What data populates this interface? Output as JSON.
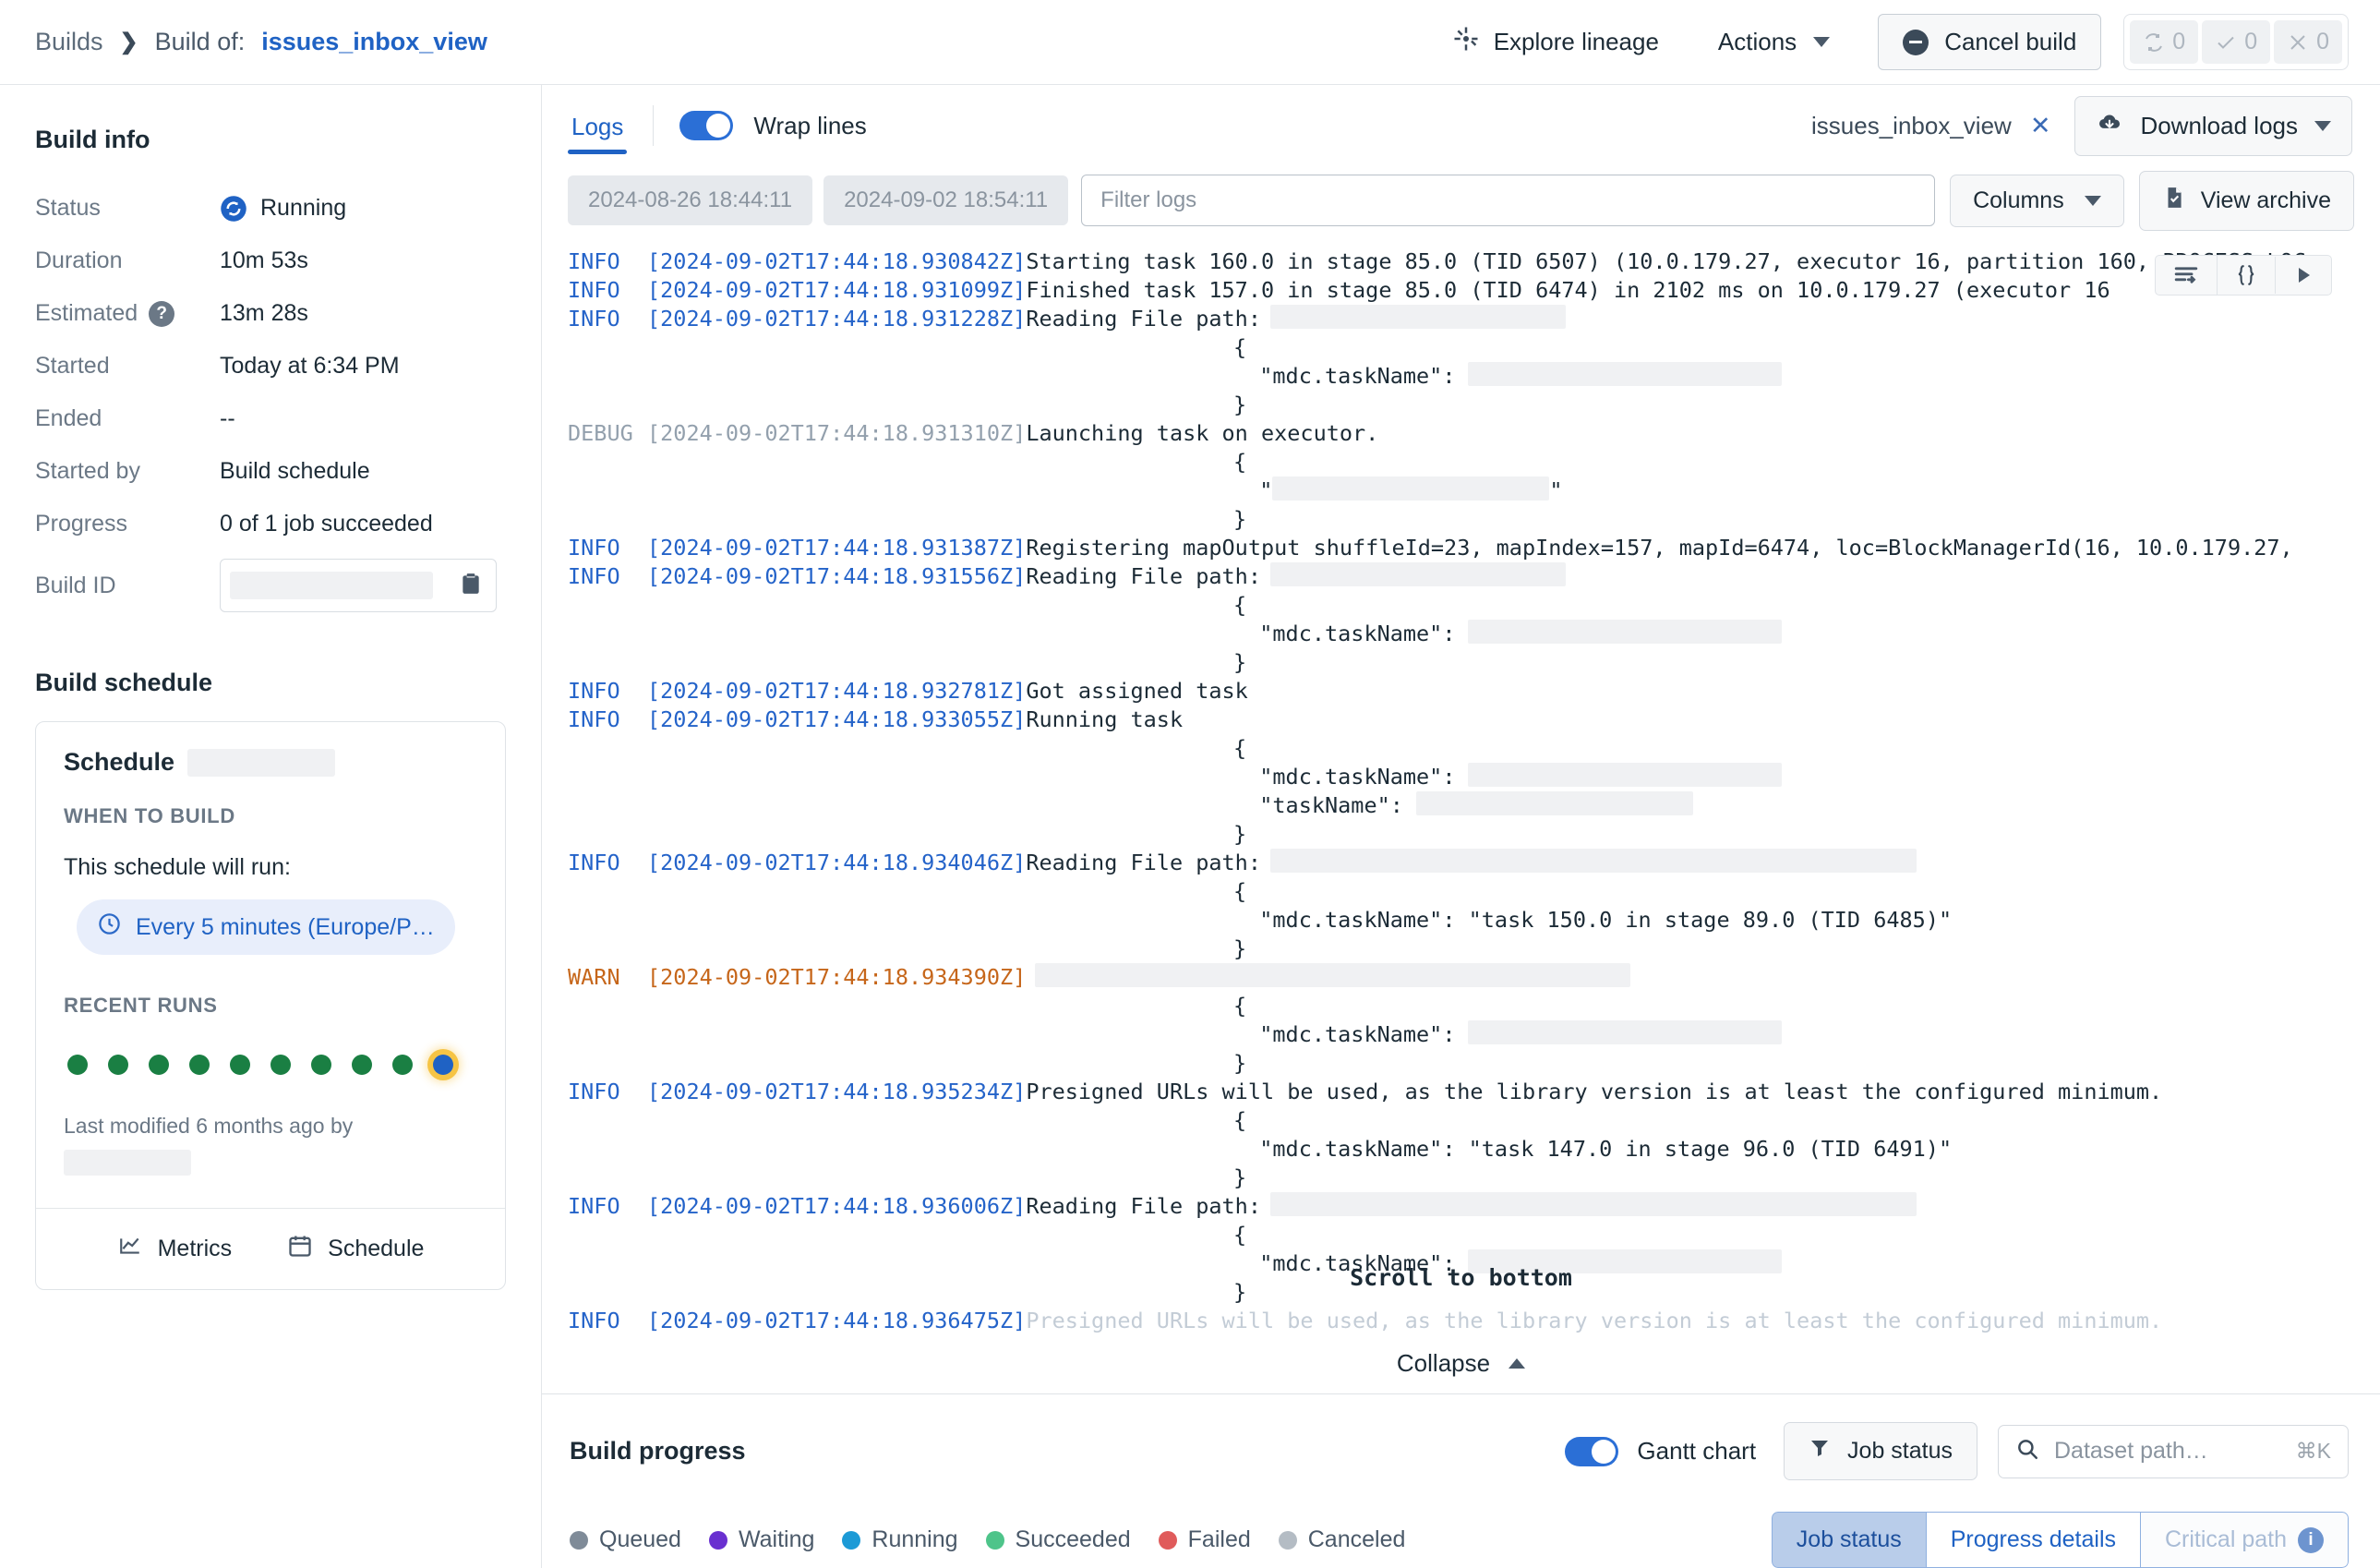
{
  "breadcrumb": {
    "root": "Builds",
    "separator": "❯",
    "prefix": "Build of:",
    "current": "issues_inbox_view"
  },
  "topbar": {
    "explore_lineage": "Explore lineage",
    "actions": "Actions",
    "cancel_build": "Cancel build",
    "counters": [
      {
        "icon": "retry-icon",
        "value": "0"
      },
      {
        "icon": "check-icon",
        "value": "0"
      },
      {
        "icon": "x-icon",
        "value": "0"
      }
    ]
  },
  "build_info": {
    "title": "Build info",
    "rows": [
      {
        "label": "Status",
        "value": "Running",
        "icon": "running-icon"
      },
      {
        "label": "Duration",
        "value": "10m 53s"
      },
      {
        "label": "Estimated",
        "value": "13m 28s",
        "help": "?"
      },
      {
        "label": "Started",
        "value": "Today at 6:34 PM"
      },
      {
        "label": "Ended",
        "value": "--"
      },
      {
        "label": "Started by",
        "value": "Build schedule"
      },
      {
        "label": "Progress",
        "value": "0 of 1 job succeeded"
      }
    ],
    "build_id_label": "Build ID",
    "build_id_value": ""
  },
  "build_schedule": {
    "heading": "Build schedule",
    "card_title": "Schedule",
    "when_to_build": "WHEN TO BUILD",
    "will_run": "This schedule will run:",
    "cadence": "Every 5 minutes (Europe/P…",
    "recent_runs_label": "RECENT RUNS",
    "recent_runs": [
      "succeeded",
      "succeeded",
      "succeeded",
      "succeeded",
      "succeeded",
      "succeeded",
      "succeeded",
      "succeeded",
      "succeeded",
      "running"
    ],
    "last_modified": "Last modified 6 months ago by",
    "last_modified_by": "",
    "footer": {
      "metrics": "Metrics",
      "schedule": "Schedule"
    }
  },
  "logs": {
    "tab_label": "Logs",
    "wrap_lines_label": "Wrap lines",
    "wrap_lines_on": true,
    "dataset_tab": "issues_inbox_view",
    "download_logs": "Download logs",
    "start_date": "2024-08-26 18:44:11",
    "end_date": "2024-09-02 18:54:11",
    "filter_placeholder": "Filter logs",
    "columns_label": "Columns",
    "view_archive_label": "View archive",
    "line_tools": [
      "wrap-toggle-icon",
      "json-braces-icon",
      "play-icon"
    ],
    "scroll_to_bottom": "Scroll to bottom",
    "collapse": "Collapse",
    "lines": [
      {
        "level": "INFO",
        "ts": "[2024-09-02T17:44:18.930842Z]",
        "msg": "Starting task 160.0 in stage 85.0 (TID 6507) (10.0.179.27, executor 16, partition 160, PROCESS_LOC"
      },
      {
        "level": "INFO",
        "ts": "[2024-09-02T17:44:18.931099Z]",
        "msg": "Finished task 157.0 in stage 85.0 (TID 6474) in 2102 ms on 10.0.179.27 (executor 16"
      },
      {
        "level": "INFO",
        "ts": "[2024-09-02T17:44:18.931228Z]",
        "msg": "Reading File path:",
        "redact": 320
      },
      {
        "level": "",
        "ts": "",
        "msg": "                    {"
      },
      {
        "level": "",
        "ts": "",
        "msg": "                      \"mdc.taskName\":",
        "redact": 340,
        "indent_redact": 14
      },
      {
        "level": "",
        "ts": "",
        "msg": "                    }"
      },
      {
        "level": "DEBUG",
        "ts": "[2024-09-02T17:44:18.931310Z]",
        "msg": "Launching task on executor."
      },
      {
        "level": "",
        "ts": "",
        "msg": "                    {"
      },
      {
        "level": "",
        "ts": "",
        "msg": "                      \"",
        "redact_mid": 300,
        "tail": "\""
      },
      {
        "level": "",
        "ts": "",
        "msg": "                    }"
      },
      {
        "level": "INFO",
        "ts": "[2024-09-02T17:44:18.931387Z]",
        "msg": "Registering mapOutput shuffleId=23, mapIndex=157, mapId=6474, loc=BlockManagerId(16, 10.0.179.27,"
      },
      {
        "level": "INFO",
        "ts": "[2024-09-02T17:44:18.931556Z]",
        "msg": "Reading File path:",
        "redact": 320
      },
      {
        "level": "",
        "ts": "",
        "msg": "                    {"
      },
      {
        "level": "",
        "ts": "",
        "msg": "                      \"mdc.taskName\":",
        "redact": 340,
        "indent_redact": 14
      },
      {
        "level": "",
        "ts": "",
        "msg": "                    }"
      },
      {
        "level": "INFO",
        "ts": "[2024-09-02T17:44:18.932781Z]",
        "msg": "Got assigned task"
      },
      {
        "level": "INFO",
        "ts": "[2024-09-02T17:44:18.933055Z]",
        "msg": "Running task"
      },
      {
        "level": "",
        "ts": "",
        "msg": "                    {"
      },
      {
        "level": "",
        "ts": "",
        "msg": "                      \"mdc.taskName\":",
        "redact": 340,
        "indent_redact": 14
      },
      {
        "level": "",
        "ts": "",
        "msg": "                      \"taskName\":",
        "redact": 300,
        "indent_redact": 14
      },
      {
        "level": "",
        "ts": "",
        "msg": "                    }"
      },
      {
        "level": "INFO",
        "ts": "[2024-09-02T17:44:18.934046Z]",
        "msg": "Reading File path:",
        "redact": 700
      },
      {
        "level": "",
        "ts": "",
        "msg": "                    {"
      },
      {
        "level": "",
        "ts": "",
        "msg": "                      \"mdc.taskName\": \"task 150.0 in stage 89.0 (TID 6485)\""
      },
      {
        "level": "",
        "ts": "",
        "msg": "                    }"
      },
      {
        "level": "WARN",
        "ts": "[2024-09-02T17:44:18.934390Z]",
        "msg": "",
        "redact": 645
      },
      {
        "level": "",
        "ts": "",
        "msg": "                    {"
      },
      {
        "level": "",
        "ts": "",
        "msg": "                      \"mdc.taskName\":",
        "redact": 340,
        "indent_redact": 14
      },
      {
        "level": "",
        "ts": "",
        "msg": "                    }"
      },
      {
        "level": "INFO",
        "ts": "[2024-09-02T17:44:18.935234Z]",
        "msg": "Presigned URLs will be used, as the library version is at least the configured minimum."
      },
      {
        "level": "",
        "ts": "",
        "msg": "                    {"
      },
      {
        "level": "",
        "ts": "",
        "msg": "                      \"mdc.taskName\": \"task 147.0 in stage 96.0 (TID 6491)\""
      },
      {
        "level": "",
        "ts": "",
        "msg": "                    }"
      },
      {
        "level": "INFO",
        "ts": "[2024-09-02T17:44:18.936006Z]",
        "msg": "Reading File path:",
        "redact": 700
      },
      {
        "level": "",
        "ts": "",
        "msg": "                    {"
      },
      {
        "level": "",
        "ts": "",
        "msg": "                      \"mdc.taskName\":",
        "redact": 340,
        "indent_redact": 14
      },
      {
        "level": "",
        "ts": "",
        "msg": "                    }"
      },
      {
        "level": "INFO",
        "ts": "[2024-09-02T17:44:18.936475Z]",
        "msg": "Presigned URLs will be used, as the library version is at least the configured minimum.",
        "dim": true
      }
    ]
  },
  "build_progress": {
    "title": "Build progress",
    "gantt_label": "Gantt chart",
    "gantt_on": true,
    "job_status_button": "Job status",
    "search_placeholder": "Dataset path…",
    "search_kbd": "⌘K",
    "legend": [
      {
        "label": "Queued",
        "color": "#7f8b98"
      },
      {
        "label": "Waiting",
        "color": "#6930d0"
      },
      {
        "label": "Running",
        "color": "#1c9ad6"
      },
      {
        "label": "Succeeded",
        "color": "#4ec48a"
      },
      {
        "label": "Failed",
        "color": "#e05b5b"
      },
      {
        "label": "Canceled",
        "color": "#b4bcc4"
      }
    ],
    "tabs": [
      {
        "label": "Job status",
        "state": "active"
      },
      {
        "label": "Progress details",
        "state": "normal"
      },
      {
        "label": "Critical path",
        "state": "disabled",
        "badge": "i"
      }
    ]
  },
  "colors": {
    "accent": "#1f62c4",
    "info": "#2463c9",
    "warn": "#c6661a",
    "debug": "#93a0ad",
    "success": "#1a7f43",
    "running_ring": "#f6c445"
  }
}
